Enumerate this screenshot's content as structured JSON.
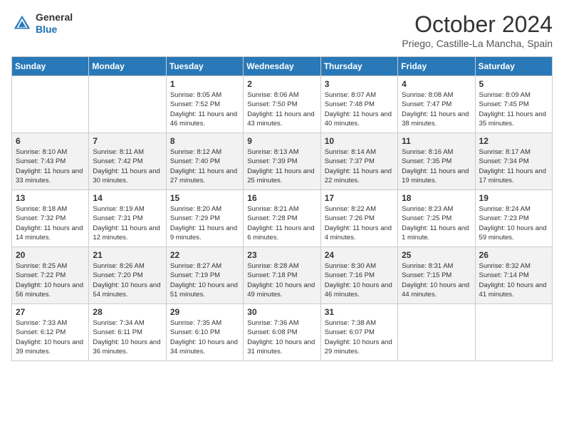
{
  "header": {
    "logo_general": "General",
    "logo_blue": "Blue",
    "month": "October 2024",
    "location": "Priego, Castille-La Mancha, Spain"
  },
  "days_of_week": [
    "Sunday",
    "Monday",
    "Tuesday",
    "Wednesday",
    "Thursday",
    "Friday",
    "Saturday"
  ],
  "weeks": [
    [
      {
        "day": "",
        "info": ""
      },
      {
        "day": "",
        "info": ""
      },
      {
        "day": "1",
        "info": "Sunrise: 8:05 AM\nSunset: 7:52 PM\nDaylight: 11 hours and 46 minutes."
      },
      {
        "day": "2",
        "info": "Sunrise: 8:06 AM\nSunset: 7:50 PM\nDaylight: 11 hours and 43 minutes."
      },
      {
        "day": "3",
        "info": "Sunrise: 8:07 AM\nSunset: 7:48 PM\nDaylight: 11 hours and 40 minutes."
      },
      {
        "day": "4",
        "info": "Sunrise: 8:08 AM\nSunset: 7:47 PM\nDaylight: 11 hours and 38 minutes."
      },
      {
        "day": "5",
        "info": "Sunrise: 8:09 AM\nSunset: 7:45 PM\nDaylight: 11 hours and 35 minutes."
      }
    ],
    [
      {
        "day": "6",
        "info": "Sunrise: 8:10 AM\nSunset: 7:43 PM\nDaylight: 11 hours and 33 minutes."
      },
      {
        "day": "7",
        "info": "Sunrise: 8:11 AM\nSunset: 7:42 PM\nDaylight: 11 hours and 30 minutes."
      },
      {
        "day": "8",
        "info": "Sunrise: 8:12 AM\nSunset: 7:40 PM\nDaylight: 11 hours and 27 minutes."
      },
      {
        "day": "9",
        "info": "Sunrise: 8:13 AM\nSunset: 7:39 PM\nDaylight: 11 hours and 25 minutes."
      },
      {
        "day": "10",
        "info": "Sunrise: 8:14 AM\nSunset: 7:37 PM\nDaylight: 11 hours and 22 minutes."
      },
      {
        "day": "11",
        "info": "Sunrise: 8:16 AM\nSunset: 7:35 PM\nDaylight: 11 hours and 19 minutes."
      },
      {
        "day": "12",
        "info": "Sunrise: 8:17 AM\nSunset: 7:34 PM\nDaylight: 11 hours and 17 minutes."
      }
    ],
    [
      {
        "day": "13",
        "info": "Sunrise: 8:18 AM\nSunset: 7:32 PM\nDaylight: 11 hours and 14 minutes."
      },
      {
        "day": "14",
        "info": "Sunrise: 8:19 AM\nSunset: 7:31 PM\nDaylight: 11 hours and 12 minutes."
      },
      {
        "day": "15",
        "info": "Sunrise: 8:20 AM\nSunset: 7:29 PM\nDaylight: 11 hours and 9 minutes."
      },
      {
        "day": "16",
        "info": "Sunrise: 8:21 AM\nSunset: 7:28 PM\nDaylight: 11 hours and 6 minutes."
      },
      {
        "day": "17",
        "info": "Sunrise: 8:22 AM\nSunset: 7:26 PM\nDaylight: 11 hours and 4 minutes."
      },
      {
        "day": "18",
        "info": "Sunrise: 8:23 AM\nSunset: 7:25 PM\nDaylight: 11 hours and 1 minute."
      },
      {
        "day": "19",
        "info": "Sunrise: 8:24 AM\nSunset: 7:23 PM\nDaylight: 10 hours and 59 minutes."
      }
    ],
    [
      {
        "day": "20",
        "info": "Sunrise: 8:25 AM\nSunset: 7:22 PM\nDaylight: 10 hours and 56 minutes."
      },
      {
        "day": "21",
        "info": "Sunrise: 8:26 AM\nSunset: 7:20 PM\nDaylight: 10 hours and 54 minutes."
      },
      {
        "day": "22",
        "info": "Sunrise: 8:27 AM\nSunset: 7:19 PM\nDaylight: 10 hours and 51 minutes."
      },
      {
        "day": "23",
        "info": "Sunrise: 8:28 AM\nSunset: 7:18 PM\nDaylight: 10 hours and 49 minutes."
      },
      {
        "day": "24",
        "info": "Sunrise: 8:30 AM\nSunset: 7:16 PM\nDaylight: 10 hours and 46 minutes."
      },
      {
        "day": "25",
        "info": "Sunrise: 8:31 AM\nSunset: 7:15 PM\nDaylight: 10 hours and 44 minutes."
      },
      {
        "day": "26",
        "info": "Sunrise: 8:32 AM\nSunset: 7:14 PM\nDaylight: 10 hours and 41 minutes."
      }
    ],
    [
      {
        "day": "27",
        "info": "Sunrise: 7:33 AM\nSunset: 6:12 PM\nDaylight: 10 hours and 39 minutes."
      },
      {
        "day": "28",
        "info": "Sunrise: 7:34 AM\nSunset: 6:11 PM\nDaylight: 10 hours and 36 minutes."
      },
      {
        "day": "29",
        "info": "Sunrise: 7:35 AM\nSunset: 6:10 PM\nDaylight: 10 hours and 34 minutes."
      },
      {
        "day": "30",
        "info": "Sunrise: 7:36 AM\nSunset: 6:08 PM\nDaylight: 10 hours and 31 minutes."
      },
      {
        "day": "31",
        "info": "Sunrise: 7:38 AM\nSunset: 6:07 PM\nDaylight: 10 hours and 29 minutes."
      },
      {
        "day": "",
        "info": ""
      },
      {
        "day": "",
        "info": ""
      }
    ]
  ]
}
